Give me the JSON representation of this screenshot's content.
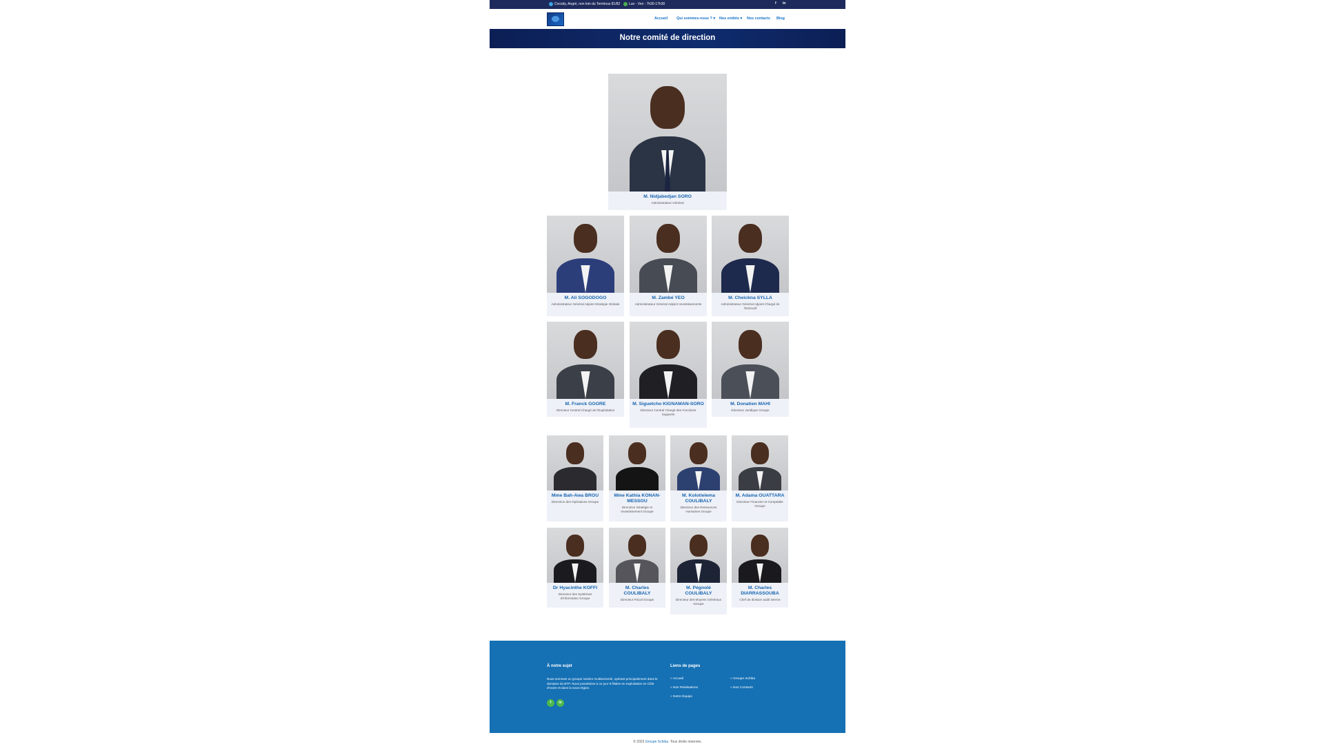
{
  "topbar": {
    "address": "Cocody, Angré, non loin du Terminus 81/82",
    "hours": "Lun - Ven : 7h30-17h30",
    "social": [
      "f",
      "in"
    ]
  },
  "nav": {
    "items": [
      {
        "label": "Accueil"
      },
      {
        "label": "Qui sommes-nous ? ▾"
      },
      {
        "label": "Nos entités ▾"
      },
      {
        "label": "Nos contacts"
      },
      {
        "label": "Blog"
      }
    ]
  },
  "banner": {
    "title": "Notre comité de direction"
  },
  "team": {
    "leader": {
      "name": "M. Nidjabedjan SORO",
      "role": "Administrateur Général"
    },
    "row1": [
      {
        "name": "M. Ali SOGODOGO",
        "role": "Administrateur Général Adjoint Stratégie Globale"
      },
      {
        "name": "M. Zambé YEO",
        "role": "Administrateur Général Adjoint Investissements"
      },
      {
        "name": "M. Cheickna SYLLA",
        "role": "Administrateur Général Adjoint Chargé de l'Exécutif"
      }
    ],
    "row2": [
      {
        "name": "M. Franck GOORE",
        "role": "Directeur Central Chargé de l'Exploitation"
      },
      {
        "name": "M. Siguetcho KIGNAMAN-SORO",
        "role": "Directeur Central Chargé des Fonctions Supports"
      },
      {
        "name": "M. Donatien MAHI",
        "role": "Directeur Juridique Groupe"
      }
    ],
    "row3": [
      {
        "name": "Mme Bah-Awa BROU",
        "role": "Directrice des Opérations Groupe"
      },
      {
        "name": "Mme Kathia KONAN-MESSOU",
        "role": "Directrice Stratégie et Investissement Groupe"
      },
      {
        "name": "M. Kolotielema COULIBALY",
        "role": "Directeur des Ressources Humaines Groupe"
      },
      {
        "name": "M. Adama OUATTARA",
        "role": "Directeur Financier et Comptable Groupe"
      }
    ],
    "row4": [
      {
        "name": "Dr Hyacinthe KOFFI",
        "role": "Directeur des Systèmes d'Information Groupe"
      },
      {
        "name": "M. Charles COULIBALY",
        "role": "Directeur Fiscal Groupe"
      },
      {
        "name": "M. Pégnolé COULIBALY",
        "role": "Directeur des Moyens Généraux Groupe"
      },
      {
        "name": "M. Charles DIARRASSOUBA",
        "role": "Chef de division audit interne"
      }
    ]
  },
  "footer": {
    "about_title": "À notre sujet",
    "about_text": "Nous sommes un groupe ivoirien multisectoriel, opérant principalement dans le domaine du BTP. Nous possédons à ce jour 9 filiales en exploitation en Côte d'Ivoire et dans la sous-région.",
    "links_title": "Liens de pages",
    "links": [
      "» Accueil",
      "» Nos Réalisations",
      "» Notre Équipe",
      "» Groupe Schiba",
      "» Nos Contacts"
    ],
    "social": [
      "f",
      "in"
    ]
  },
  "copyright": {
    "prefix": "© 2023",
    "brand": "Groupe Schiba",
    "suffix": ". Tous droits réservés."
  }
}
